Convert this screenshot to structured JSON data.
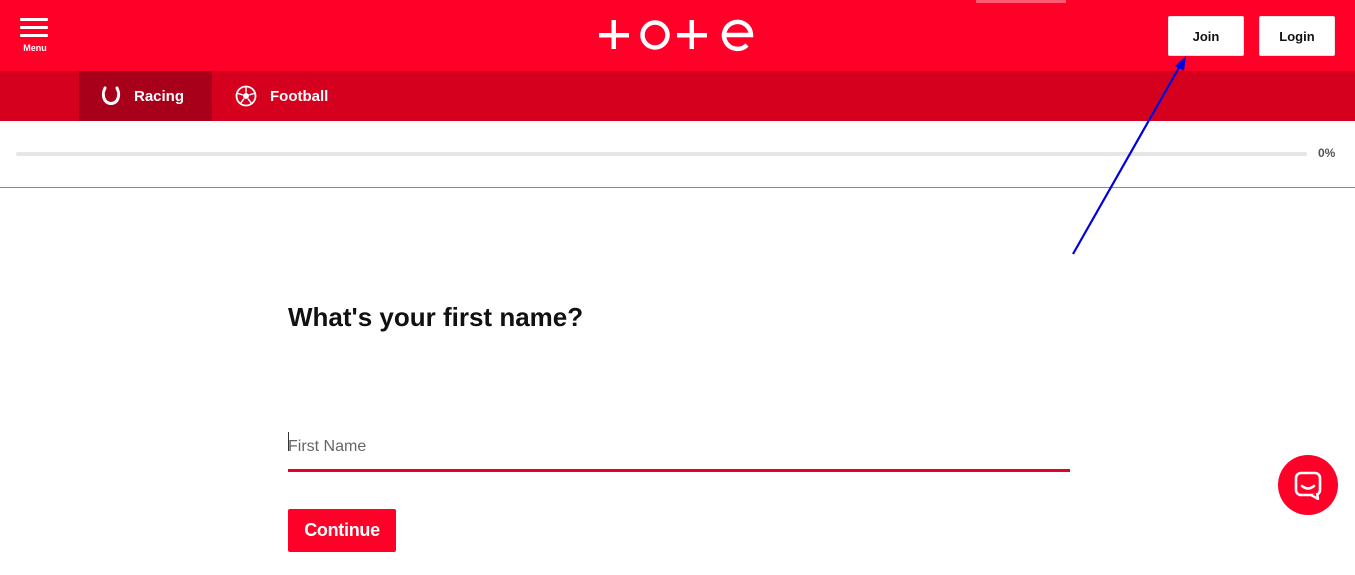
{
  "header": {
    "menu_label": "Menu",
    "brand": "tote",
    "join_label": "Join",
    "login_label": "Login"
  },
  "nav": {
    "items": [
      {
        "label": "Racing",
        "icon": "horseshoe-icon",
        "active": true
      },
      {
        "label": "Football",
        "icon": "football-icon",
        "active": false
      }
    ]
  },
  "progress": {
    "value_percent": 0,
    "label": "0%"
  },
  "form": {
    "question": "What's your first name?",
    "first_name_placeholder": "First Name",
    "first_name_value": "",
    "continue_label": "Continue"
  },
  "colors": {
    "brand_red": "#ff0029",
    "nav_red": "#d4001e",
    "nav_active": "#a8001a",
    "annotation_arrow": "#0000dd"
  },
  "chat": {
    "icon": "chat-icon"
  }
}
